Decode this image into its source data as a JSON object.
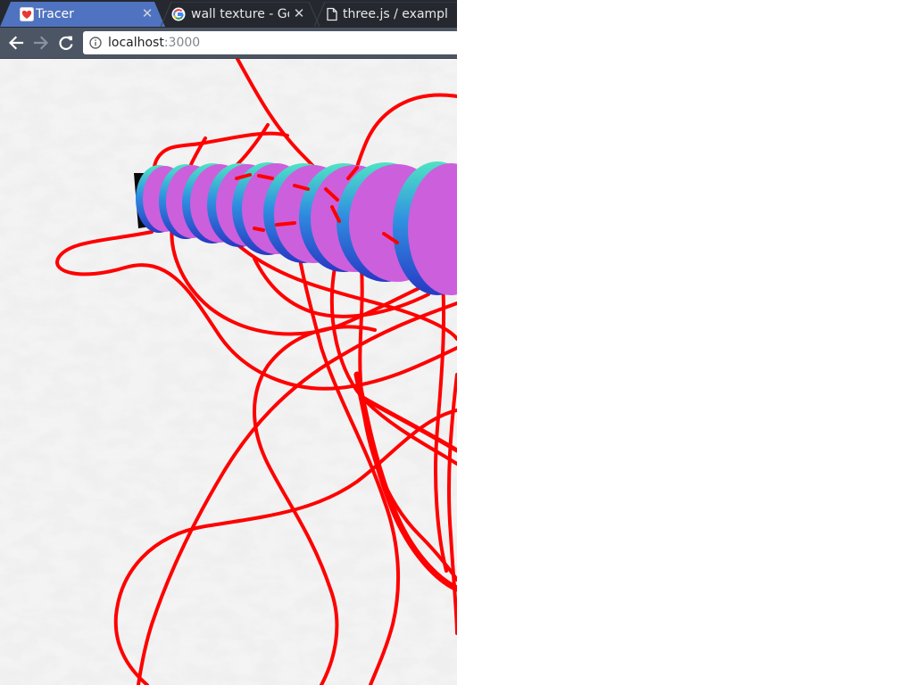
{
  "tabs": [
    {
      "title": "Tracer",
      "favicon": "heart-favicon-icon",
      "active": true
    },
    {
      "title": "wall texture - Go",
      "favicon": "google-favicon-icon",
      "active": false
    },
    {
      "title": "three.js / exampl",
      "favicon": "page-icon",
      "active": false
    }
  ],
  "toolbar": {
    "back": "back-arrow-icon",
    "forward": "forward-arrow-icon",
    "reload": "reload-icon",
    "info": "info-icon"
  },
  "address": {
    "host": "localhost",
    "port": ":3000"
  },
  "scene": {
    "description_colors": {
      "background": "#efefef",
      "trace_line": "#ff0000",
      "disc_face": "#cc5fdc",
      "disc_rim_top": "#4fe3c4",
      "disc_rim_bottom": "#2640c8"
    }
  }
}
